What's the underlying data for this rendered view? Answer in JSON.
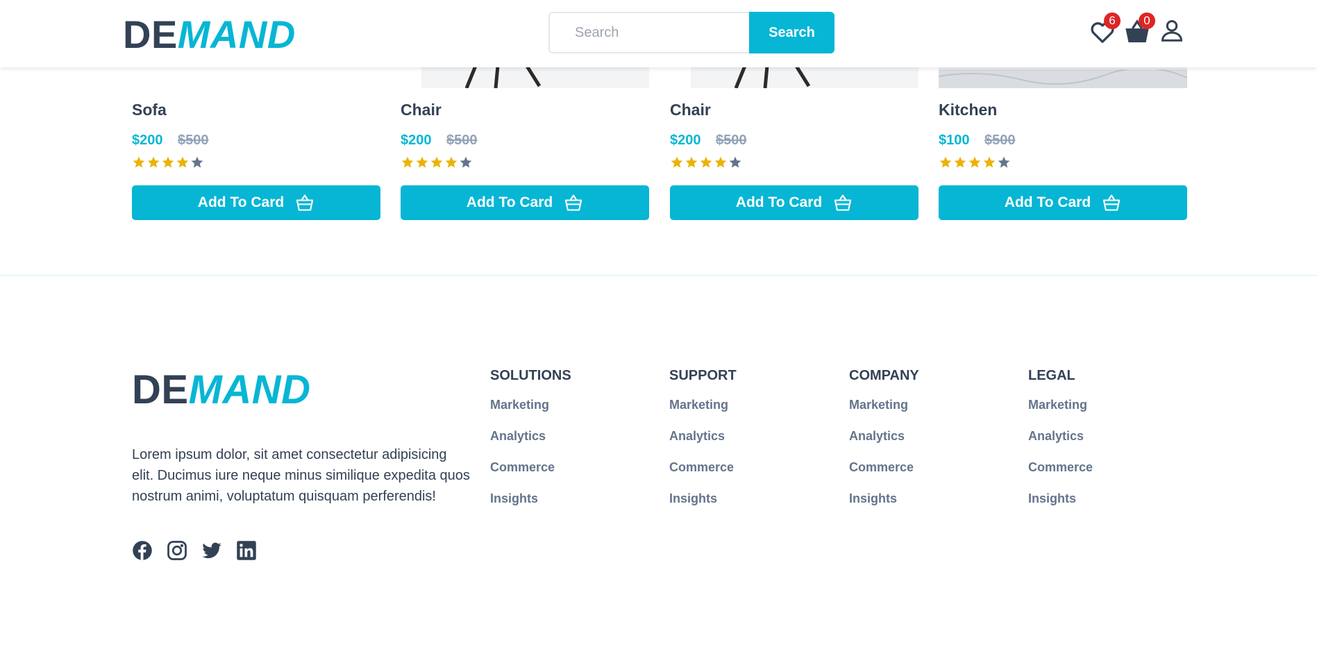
{
  "brand": {
    "part1": "DE",
    "part2": "MAND"
  },
  "search": {
    "placeholder": "Search",
    "button_label": "Search"
  },
  "header": {
    "wishlist_count": "6",
    "cart_count": "0"
  },
  "products": [
    {
      "title": "Sofa",
      "price": "$200",
      "old_price": "$500",
      "rating": 4,
      "button_label": "Add To Card"
    },
    {
      "title": "Chair",
      "price": "$200",
      "old_price": "$500",
      "rating": 4,
      "button_label": "Add To Card"
    },
    {
      "title": "Chair",
      "price": "$200",
      "old_price": "$500",
      "rating": 4,
      "button_label": "Add To Card"
    },
    {
      "title": "Kitchen",
      "price": "$100",
      "old_price": "$500",
      "rating": 4,
      "button_label": "Add To Card"
    }
  ],
  "footer": {
    "description": "Lorem ipsum dolor, sit amet consectetur adipisicing elit. Ducimus iure neque minus similique expedita quos nostrum animi, voluptatum quisquam perferendis!",
    "socials": [
      "facebook-icon",
      "instagram-icon",
      "twitter-icon",
      "linkedin-icon"
    ],
    "columns": [
      {
        "heading": "SOLUTIONS",
        "links": [
          "Marketing",
          "Analytics",
          "Commerce",
          "Insights"
        ]
      },
      {
        "heading": "SUPPORT",
        "links": [
          "Marketing",
          "Analytics",
          "Commerce",
          "Insights"
        ]
      },
      {
        "heading": "COMPANY",
        "links": [
          "Marketing",
          "Analytics",
          "Commerce",
          "Insights"
        ]
      },
      {
        "heading": "LEGAL",
        "links": [
          "Marketing",
          "Analytics",
          "Commerce",
          "Insights"
        ]
      }
    ]
  },
  "colors": {
    "accent": "#06b6d4",
    "dark": "#334155",
    "muted": "#94a3b8",
    "star": "#eab308",
    "star_empty": "#64748b",
    "badge": "#dc2626"
  }
}
